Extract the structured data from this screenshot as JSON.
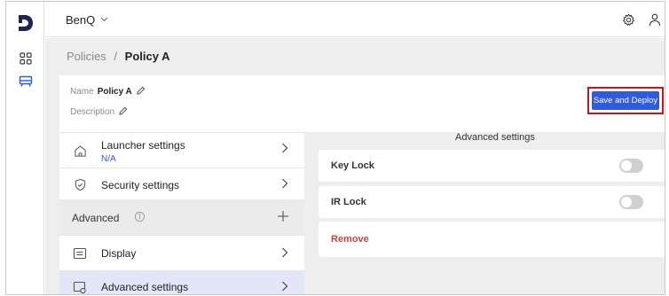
{
  "topbar": {
    "org_name": "BenQ"
  },
  "breadcrumb": {
    "parent": "Policies",
    "separator": "/",
    "current": "Policy A"
  },
  "policy": {
    "name_label": "Name",
    "name_value": "Policy A",
    "description_label": "Description",
    "deploy_label": "Save and Deploy"
  },
  "nav": {
    "launcher": {
      "label": "Launcher settings",
      "sub": "N/A",
      "icon": "home-icon"
    },
    "security": {
      "label": "Security settings",
      "icon": "shield-icon"
    },
    "advanced_header": {
      "label": "Advanced",
      "icon": "info-icon"
    },
    "display": {
      "label": "Display",
      "icon": "display-icon"
    },
    "advanced_settings": {
      "label": "Advanced settings",
      "icon": "advanced-settings-icon"
    }
  },
  "panel": {
    "title": "Advanced settings",
    "rows": [
      {
        "label": "Key Lock",
        "enabled": false
      },
      {
        "label": "IR Lock",
        "enabled": false
      }
    ],
    "remove_label": "Remove"
  },
  "colors": {
    "accent": "#2f5bdc",
    "highlight_outline": "#c8141d",
    "remove": "#d14040",
    "selected_row": "#e3e6f7",
    "content_bg": "#eeeeee"
  }
}
